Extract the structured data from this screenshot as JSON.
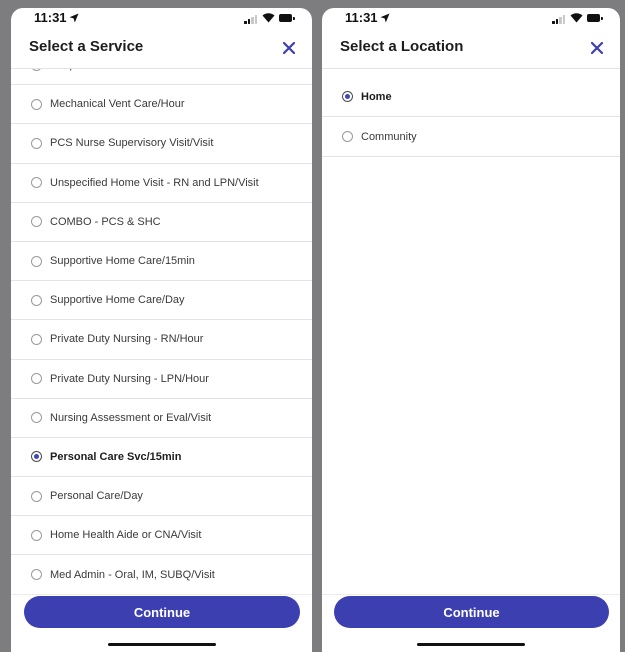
{
  "colors": {
    "accent": "#3c3fb0",
    "background": "#7d7d80",
    "divider": "#e3e3e6"
  },
  "left_screen": {
    "status_time": "11:31",
    "title": "Select a Service",
    "close_icon": "close-icon",
    "items": [
      {
        "label": "Unspecified Home Visit - LPN/Visit",
        "selected": false
      },
      {
        "label": "Mechanical Vent Care/Hour",
        "selected": false
      },
      {
        "label": "PCS Nurse Supervisory Visit/Visit",
        "selected": false
      },
      {
        "label": "Unspecified Home Visit - RN and LPN/Visit",
        "selected": false
      },
      {
        "label": "COMBO - PCS & SHC",
        "selected": false
      },
      {
        "label": "Supportive Home Care/15min",
        "selected": false
      },
      {
        "label": "Supportive Home Care/Day",
        "selected": false
      },
      {
        "label": "Private Duty Nursing - RN/Hour",
        "selected": false
      },
      {
        "label": "Private Duty Nursing - LPN/Hour",
        "selected": false
      },
      {
        "label": "Nursing Assessment or Eval/Visit",
        "selected": false
      },
      {
        "label": "Personal Care Svc/15min",
        "selected": true
      },
      {
        "label": "Personal Care/Day",
        "selected": false
      },
      {
        "label": "Home Health Aide or CNA/Visit",
        "selected": false
      },
      {
        "label": "Med Admin - Oral, IM, SUBQ/Visit",
        "selected": false
      }
    ],
    "continue_label": "Continue"
  },
  "right_screen": {
    "status_time": "11:31",
    "title": "Select a Location",
    "close_icon": "close-icon",
    "items": [
      {
        "label": "Home",
        "selected": true
      },
      {
        "label": "Community",
        "selected": false
      }
    ],
    "continue_label": "Continue"
  }
}
